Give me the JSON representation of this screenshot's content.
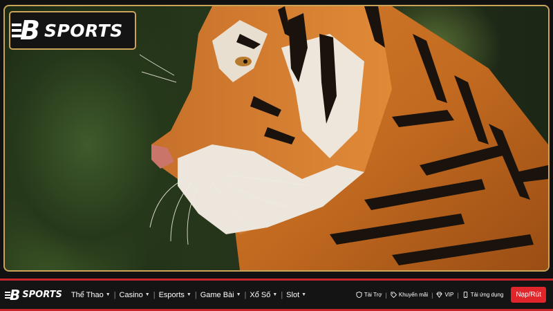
{
  "hero": {
    "image": "tiger-portrait",
    "frame_color": "#c9a45a"
  },
  "logo": {
    "mark": "B",
    "text": "SPORTS"
  },
  "nav": {
    "logo_mark": "B",
    "logo_text": "SPORTS",
    "items": [
      {
        "label": "Thể Thao"
      },
      {
        "label": "Casino"
      },
      {
        "label": "Esports"
      },
      {
        "label": "Game Bài"
      },
      {
        "label": "Xổ Số"
      },
      {
        "label": "Slot"
      }
    ],
    "utilities": [
      {
        "label": "Tài Trợ",
        "icon": "shield-icon"
      },
      {
        "label": "Khuyến mãi",
        "icon": "tag-icon"
      },
      {
        "label": "VIP",
        "icon": "diamond-icon"
      },
      {
        "label": "Tải ứng dụng",
        "icon": "phone-icon"
      }
    ],
    "cta_label": "Nạp/Rút"
  },
  "colors": {
    "accent_red": "#e1262b",
    "gold": "#c9a45a",
    "bar_bg": "#141414"
  }
}
